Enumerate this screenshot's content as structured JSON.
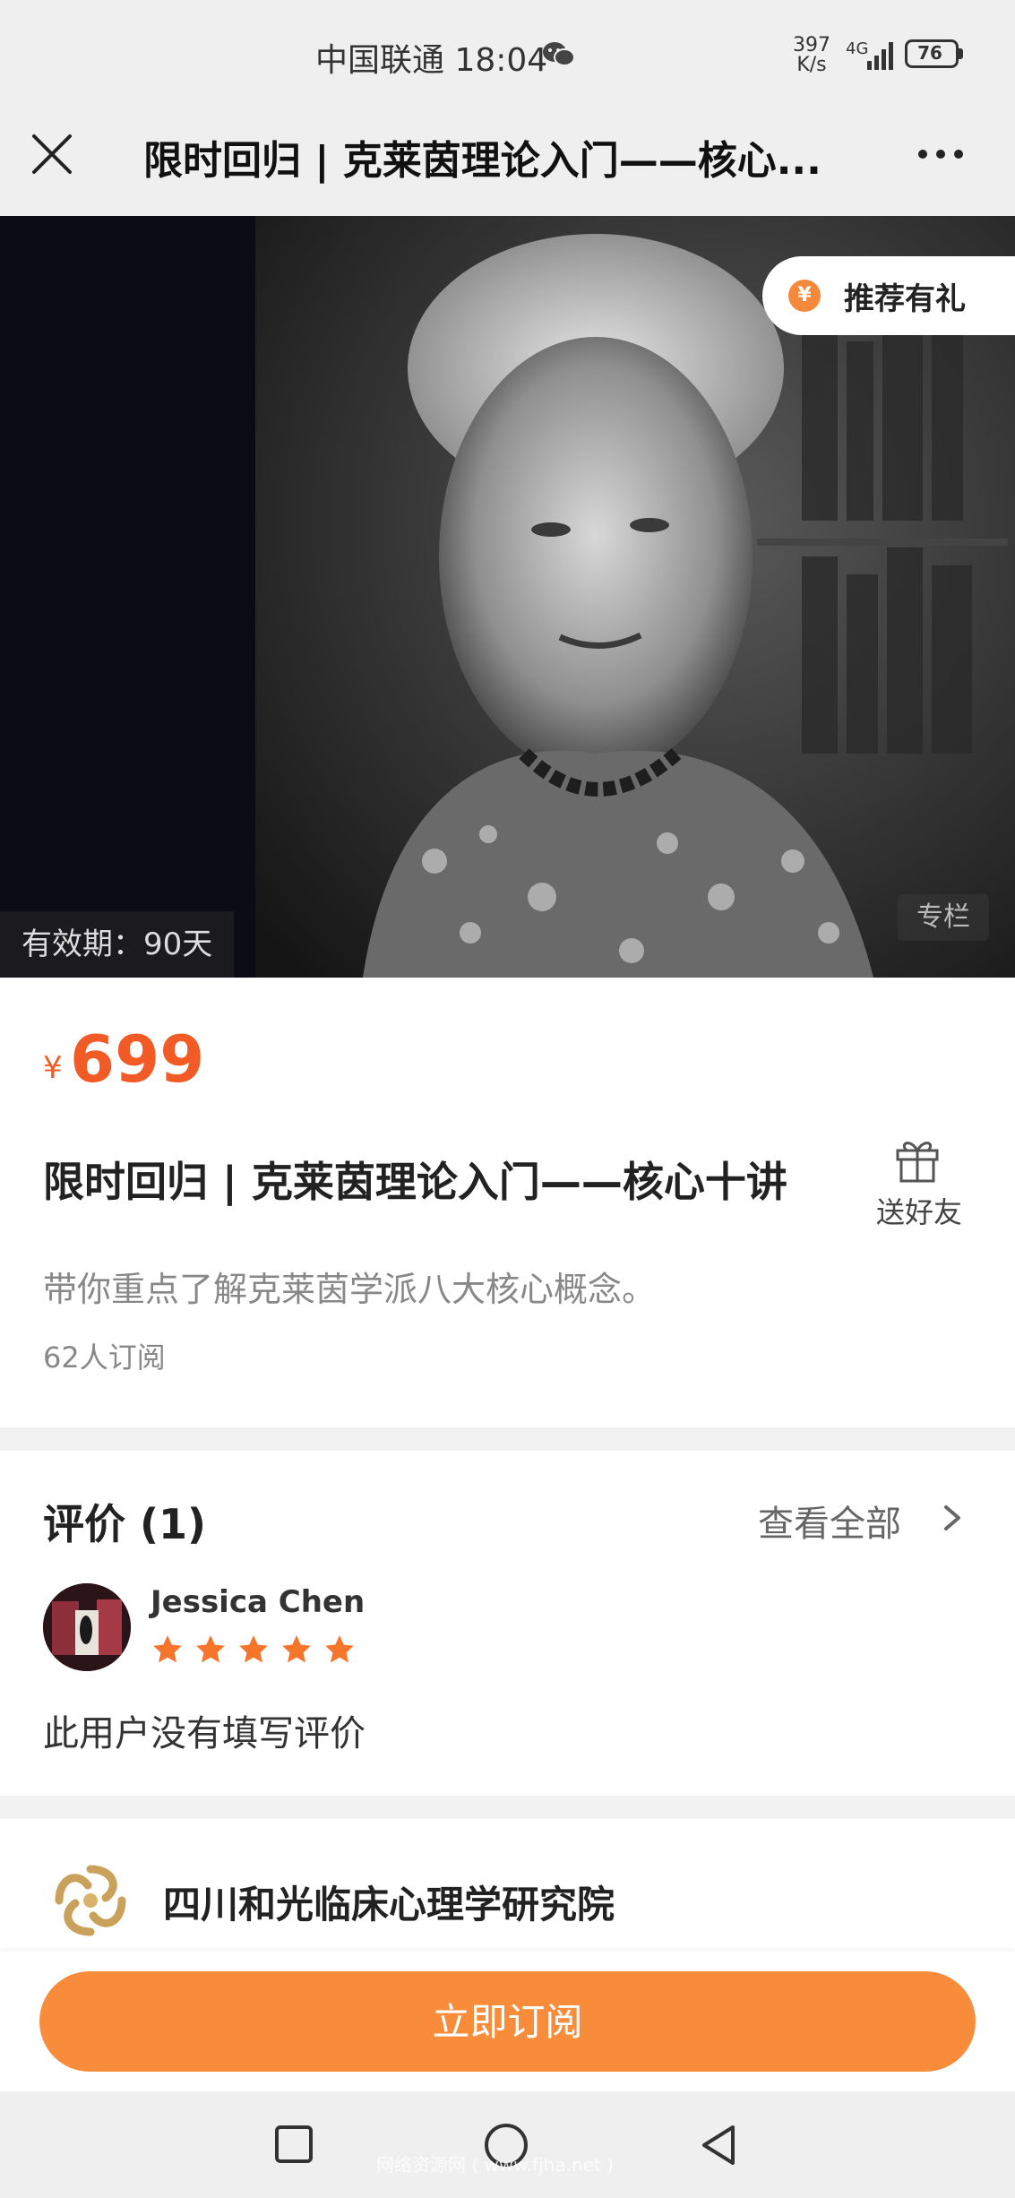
{
  "status_bar": {
    "carrier_time": "中国联通 18:04",
    "speed_value": "397",
    "speed_unit": "K/s",
    "network": "4G",
    "battery": "76"
  },
  "title_bar": {
    "title": "限时回归 | 克莱茵理论入门——核心..."
  },
  "hero": {
    "recommend_coin": "¥",
    "recommend_label": "推荐有礼",
    "validity": "有效期：90天",
    "column_tag": "专栏"
  },
  "product": {
    "price_symbol": "¥",
    "price": "699",
    "title": "限时回归 | 克莱茵理论入门——核心十讲",
    "gift_label": "送好友",
    "description": "带你重点了解克莱茵学派八大核心概念。",
    "subscribers": "62人订阅"
  },
  "reviews": {
    "heading": "评价 (1)",
    "view_all": "查看全部",
    "items": [
      {
        "name": "Jessica Chen",
        "rating": 5,
        "text": "此用户没有填写评价"
      }
    ]
  },
  "provider": {
    "name": "四川和光临床心理学研究院"
  },
  "bottom_bar": {
    "subscribe_label": "立即订阅"
  },
  "watermark": "网络资源网 ( www.fjha.net )",
  "colors": {
    "accent": "#f98c3b",
    "price": "#f25a26"
  }
}
